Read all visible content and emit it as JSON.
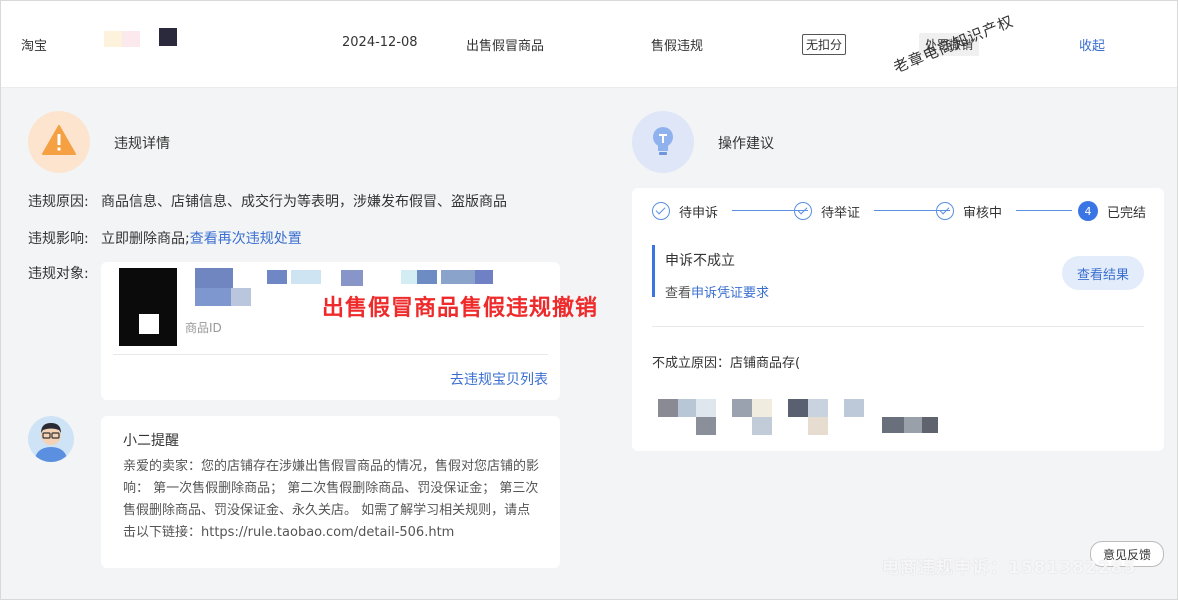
{
  "record": {
    "platform": "淘宝",
    "date": "2024-12-08",
    "category": "出售假冒商品",
    "type": "售假违规",
    "points_tag": "无扣分",
    "penalty": "处罚撤销",
    "collapse": "收起"
  },
  "watermark_diagonal": "老章电商知识产权",
  "violation": {
    "title": "违规详情",
    "reason_label": "违规原因:",
    "reason_text": "商品信息、店铺信息、成交行为等表明，涉嫌发布假冒、盗版商品",
    "impact_label": "违规影响:",
    "impact_text": "立即删除商品;",
    "impact_link": "查看再次违规处置",
    "target_label": "违规对象:",
    "goods_id_label": "商品ID",
    "goods_list_link": "去违规宝贝列表",
    "overlay_text": "出售假冒商品售假违规撤销"
  },
  "tip": {
    "title": "小二提醒",
    "body": "亲爱的卖家：您的店铺存在涉嫌出售假冒商品的情况，售假对您店铺的影响： 第一次售假删除商品； 第二次售假删除商品、罚没保证金； 第三次售假删除商品、罚没保证金、永久关店。 如需了解学习相关规则，请点击以下链接：https://rule.taobao.com/detail-506.htm"
  },
  "advice": {
    "title": "操作建议",
    "steps": [
      {
        "label": "待申诉",
        "state": "done"
      },
      {
        "label": "待举证",
        "state": "done"
      },
      {
        "label": "审核中",
        "state": "done"
      },
      {
        "label": "已完结",
        "state": "current",
        "number": "4"
      }
    ],
    "result_title": "申诉不成立",
    "result_prefix": "查看",
    "result_link": "申诉凭证要求",
    "view_button": "查看结果",
    "fail_reason": "不成立原因：店铺商品存("
  },
  "feedback_button": "意见反馈",
  "watermark_bottom": "电商违规申诉：1581382285",
  "colors": {
    "link": "#3a6fd0",
    "step": "#5b8fe0",
    "overlay_red": "#ee2a2a",
    "warn_bg": "#fde4cf",
    "warn_icon": "#f5a043"
  }
}
